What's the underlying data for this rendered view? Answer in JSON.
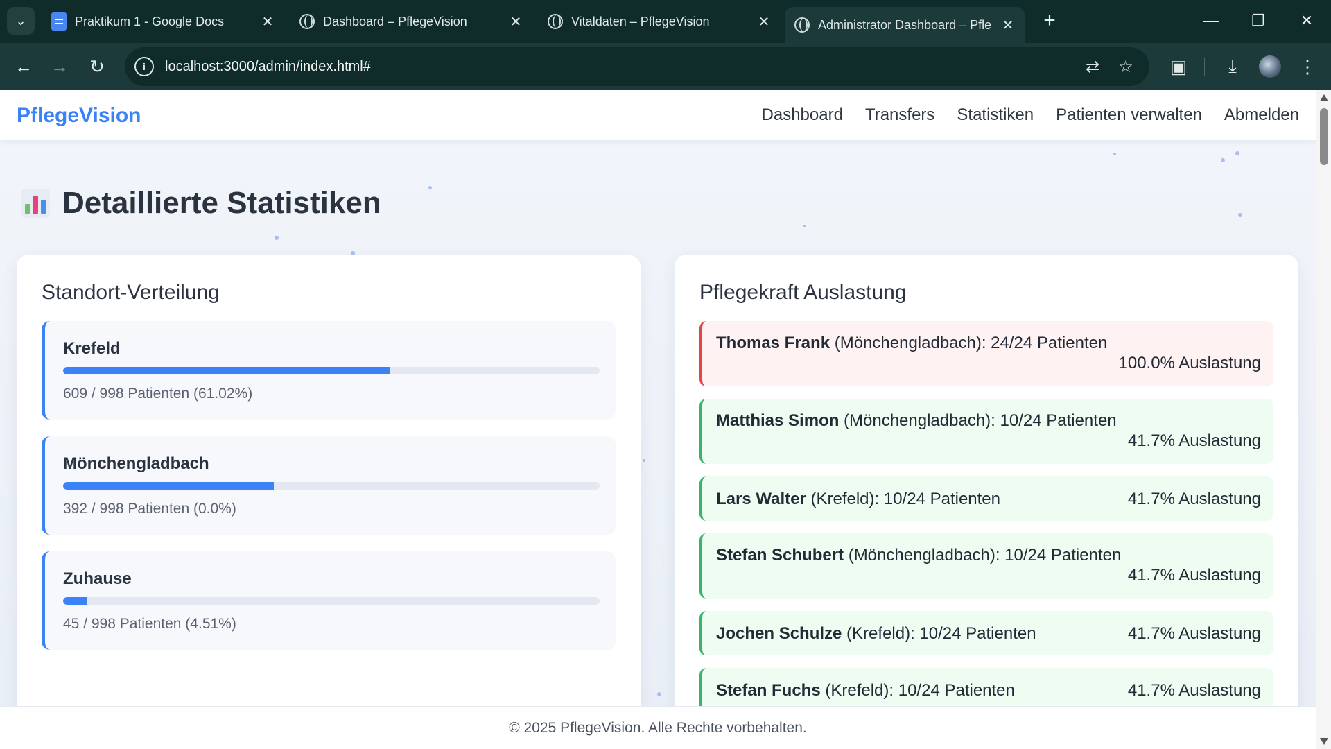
{
  "browser": {
    "tabs": [
      {
        "title": "Praktikum 1 - Google Docs",
        "icon": "google-docs-icon",
        "active": false
      },
      {
        "title": "Dashboard – PflegeVision",
        "icon": "globe-icon",
        "active": false
      },
      {
        "title": "Vitaldaten – PflegeVision",
        "icon": "globe-icon",
        "active": false
      },
      {
        "title": "Administrator Dashboard – Pfle",
        "icon": "globe-icon",
        "active": true
      }
    ],
    "url": "localhost:3000/admin/index.html#"
  },
  "header": {
    "brand": "PflegeVision",
    "nav": [
      "Dashboard",
      "Transfers",
      "Statistiken",
      "Patienten verwalten",
      "Abmelden"
    ]
  },
  "page": {
    "title": "Detaillierte Statistiken",
    "title_icon": "bar-chart-icon"
  },
  "standorte": {
    "title": "Standort-Verteilung",
    "items": [
      {
        "name": "Krefeld",
        "text": "609 / 998 Patienten (61.02%)",
        "share": 0.6102
      },
      {
        "name": "Mönchengladbach",
        "text": "392 / 998 Patienten (0.0%)",
        "share": 0.3928
      },
      {
        "name": "Zuhause",
        "text": "45 / 998 Patienten (4.51%)",
        "share": 0.0451
      }
    ]
  },
  "auslastung": {
    "title": "Pflegekraft Auslastung",
    "items": [
      {
        "name": "Thomas Frank",
        "detail": " (Mönchengladbach): 24/24 Patienten",
        "load": "100.0% Auslastung",
        "status": "over"
      },
      {
        "name": "Matthias Simon",
        "detail": " (Mönchengladbach): 10/24 Patienten",
        "load": "41.7% Auslastung",
        "status": "ok"
      },
      {
        "name": "Lars Walter",
        "detail": " (Krefeld): 10/24 Patienten",
        "load": "41.7% Auslastung",
        "status": "ok"
      },
      {
        "name": "Stefan Schubert",
        "detail": " (Mönchengladbach): 10/24 Patienten",
        "load": "41.7% Auslastung",
        "status": "ok"
      },
      {
        "name": "Jochen Schulze",
        "detail": " (Krefeld): 10/24 Patienten",
        "load": "41.7% Auslastung",
        "status": "ok"
      },
      {
        "name": "Stefan Fuchs",
        "detail": " (Krefeld): 10/24 Patienten",
        "load": "41.7% Auslastung",
        "status": "ok"
      }
    ]
  },
  "footer": {
    "text": "© 2025 PflegeVision. Alle Rechte vorbehalten."
  },
  "colors": {
    "brand": "#3b82f6",
    "over": "#e04848",
    "ok": "#3bb36a"
  }
}
